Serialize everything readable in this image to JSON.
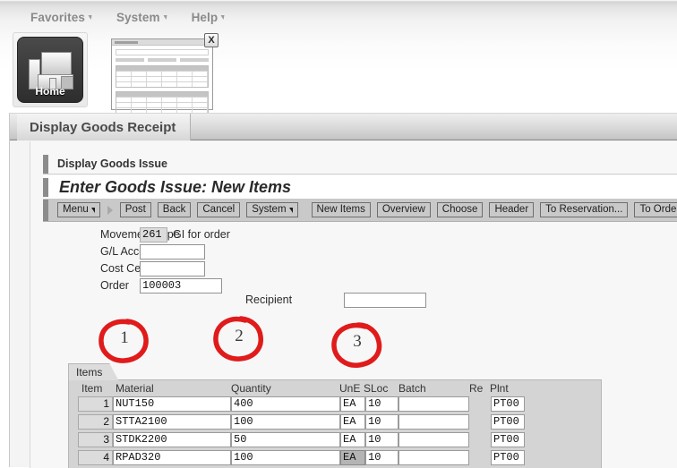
{
  "portal": {
    "menus": [
      {
        "label": "Favorites",
        "icon": "chevron-down-icon"
      },
      {
        "label": "System",
        "icon": "chevron-down-icon"
      },
      {
        "label": "Help",
        "icon": "chevron-down-icon"
      }
    ],
    "home_tile": {
      "label": "Home",
      "icon": "building-icon"
    },
    "thumbnail": {
      "close_label": "X",
      "icon": "window-thumbnail-icon"
    }
  },
  "window": {
    "tab_title": "Display Goods Receipt",
    "breadcrumb": "Display Goods Issue",
    "heading": "Enter Goods Issue: New Items"
  },
  "toolbar": {
    "buttons": [
      {
        "label": "Menu",
        "has_caret": true
      },
      {
        "label": "Post",
        "has_caret": false
      },
      {
        "label": "Back",
        "has_caret": false
      },
      {
        "label": "Cancel",
        "has_caret": false
      },
      {
        "label": "System",
        "has_caret": true
      },
      {
        "label": "New Items",
        "has_caret": false
      },
      {
        "label": "Overview",
        "has_caret": false
      },
      {
        "label": "Choose",
        "has_caret": false
      },
      {
        "label": "Header",
        "has_caret": false
      },
      {
        "label": "To Reservation...",
        "has_caret": false
      },
      {
        "label": "To Order...",
        "has_caret": false
      }
    ]
  },
  "form": {
    "movement_type": {
      "label": "Movement Type",
      "value": "261",
      "description": "GI for order",
      "readonly": true
    },
    "gl_account": {
      "label": "G/L Account",
      "value": "",
      "placeholder": ""
    },
    "cost_center": {
      "label": "Cost Center",
      "value": "",
      "placeholder": ""
    },
    "order": {
      "label": "Order",
      "value": "100003",
      "placeholder": ""
    },
    "recipient": {
      "label": "Recipient",
      "value": "",
      "placeholder": ""
    }
  },
  "items": {
    "tab_label": "Items",
    "columns": [
      "Item",
      "Material",
      "Quantity",
      "UnE",
      "SLoc",
      "Batch",
      "Re",
      "Plnt"
    ],
    "rows": [
      {
        "item": "1",
        "material": "NUT150",
        "quantity": "400",
        "une": "EA",
        "sloc": "10",
        "batch": "",
        "re": "",
        "plnt": "PT00",
        "une_selected": false
      },
      {
        "item": "2",
        "material": "STTA2100",
        "quantity": "100",
        "une": "EA",
        "sloc": "10",
        "batch": "",
        "re": "",
        "plnt": "PT00",
        "une_selected": false
      },
      {
        "item": "3",
        "material": "STDK2200",
        "quantity": "50",
        "une": "EA",
        "sloc": "10",
        "batch": "",
        "re": "",
        "plnt": "PT00",
        "une_selected": false
      },
      {
        "item": "4",
        "material": "RPAD320",
        "quantity": "100",
        "une": "EA",
        "sloc": "10",
        "batch": "",
        "re": "",
        "plnt": "PT00",
        "une_selected": true
      }
    ]
  },
  "annotations": {
    "color": "#e01b1b",
    "marks": [
      {
        "number": "1",
        "target": "material-column"
      },
      {
        "number": "2",
        "target": "quantity-column"
      },
      {
        "number": "3",
        "target": "une-sloc-column"
      }
    ]
  }
}
